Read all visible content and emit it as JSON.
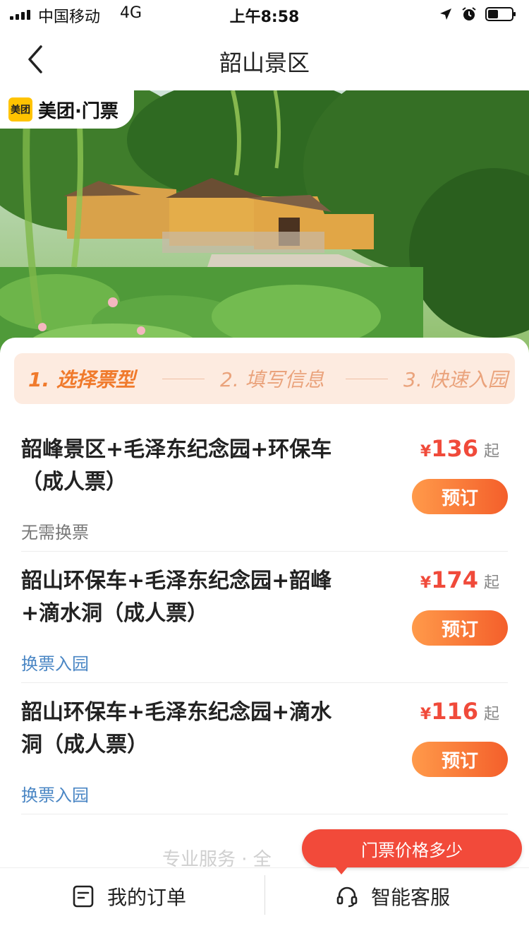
{
  "status_bar": {
    "carrier": "中国移动",
    "network": "4G",
    "time": "上午8:58"
  },
  "nav": {
    "title": "韶山景区"
  },
  "brand": {
    "logo_text": "美团",
    "name": "美团·门票"
  },
  "steps": [
    {
      "label": "1. 选择票型",
      "active": true
    },
    {
      "label": "2. 填写信息",
      "active": false
    },
    {
      "label": "3. 快速入园",
      "active": false
    }
  ],
  "tickets": [
    {
      "name": "韶峰景区+毛泽东纪念园+环保车（成人票）",
      "note": "无需换票",
      "currency": "¥",
      "price": "136",
      "suffix": "起",
      "button": "预订"
    },
    {
      "name": "韶山环保车+毛泽东纪念园+韶峰+滴水洞（成人票）",
      "note": "换票入园",
      "currency": "¥",
      "price": "174",
      "suffix": "起",
      "button": "预订"
    },
    {
      "name": "韶山环保车+毛泽东纪念园+滴水洞（成人票）",
      "note": "换票入园",
      "currency": "¥",
      "price": "116",
      "suffix": "起",
      "button": "预订"
    }
  ],
  "footer_faded": "专业服务 · 全",
  "chat_bubble": "门票价格多少",
  "bottom_bar": {
    "orders": "我的订单",
    "service": "智能客服"
  },
  "colors": {
    "accent": "#f45f2b",
    "price": "#f04a3a",
    "steps_bg": "#fdebe0",
    "link_blue": "#4a86c4",
    "brand_yellow": "#ffc300"
  }
}
